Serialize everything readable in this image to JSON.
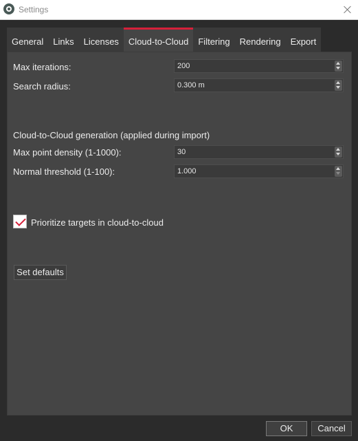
{
  "window": {
    "title": "Settings"
  },
  "tabs": [
    {
      "label": "General"
    },
    {
      "label": "Links"
    },
    {
      "label": "Licenses"
    },
    {
      "label": "Cloud-to-Cloud"
    },
    {
      "label": "Filtering"
    },
    {
      "label": "Rendering"
    },
    {
      "label": "Export"
    }
  ],
  "active_tab": "Cloud-to-Cloud",
  "fields": {
    "max_iterations": {
      "label": "Max iterations:",
      "value": "200"
    },
    "search_radius": {
      "label": "Search radius:",
      "value": "0.300 m"
    },
    "max_point_density": {
      "label": "Max point density (1-1000):",
      "value": "30"
    },
    "normal_threshold": {
      "label": "Normal threshold (1-100):",
      "value": "1.000"
    }
  },
  "section": {
    "generation_title": "Cloud-to-Cloud generation (applied during import)"
  },
  "checkbox": {
    "prioritize_targets": {
      "label": "Prioritize targets in cloud-to-cloud",
      "checked": true
    }
  },
  "buttons": {
    "set_defaults": "Set defaults",
    "ok": "OK",
    "cancel": "Cancel"
  },
  "colors": {
    "accent": "#d6203a",
    "panel_bg": "#454545",
    "window_bg": "#2b2b2b"
  }
}
